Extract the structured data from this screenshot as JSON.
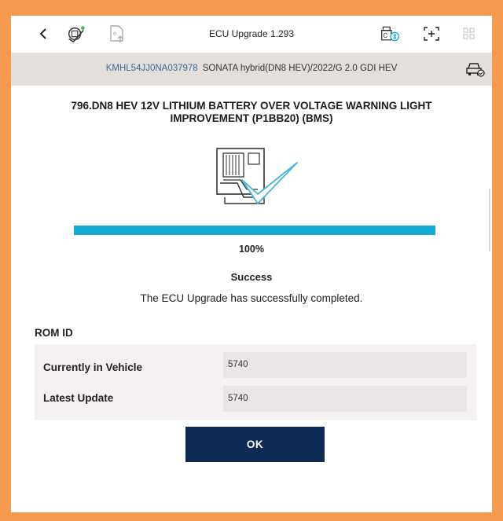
{
  "header": {
    "title": "ECU Upgrade 1.293",
    "icons": [
      "back-icon",
      "ecu-check-icon",
      "upload-icon",
      "bluetooth-vci-icon",
      "screenshot-icon",
      "grid-menu-icon"
    ]
  },
  "vehicle": {
    "vin": "KMHL54JJ0NA037978",
    "description": "SONATA hybrid(DN8 HEV)/2022/G 2.0 GDI HEV",
    "icon": "vehicle-status-icon"
  },
  "upgrade": {
    "title": "796.DN8 HEV 12V LITHIUM BATTERY OVER VOLTAGE WARNING LIGHT IMPROVEMENT (P1BB20) (BMS)",
    "progress_fraction": 1.0,
    "progress_text": "100%",
    "status": "Success",
    "message": "The ECU Upgrade has successfully completed."
  },
  "rom": {
    "label": "ROM ID",
    "rows": [
      {
        "label": "Currently in Vehicle",
        "value": "5740"
      },
      {
        "label": "Latest Update",
        "value": "5740"
      }
    ]
  },
  "actions": {
    "ok_label": "OK"
  },
  "colors": {
    "frame_border": "#f59a4f",
    "progress": "#14a9d1",
    "button": "#0d2a52",
    "vin": "#3a6a9a",
    "check": "#4ab6d6"
  }
}
